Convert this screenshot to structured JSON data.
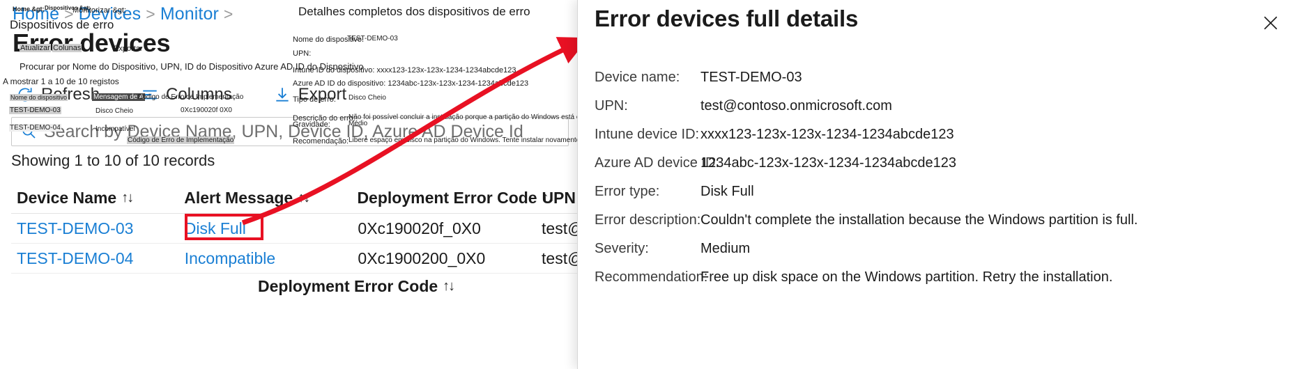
{
  "portal": {
    "breadcrumb": {
      "items": [
        "Home",
        "Devices",
        "Monitor"
      ],
      "separator": ">"
    },
    "page_title": "Error devices",
    "commands": [
      {
        "label": "Refresh",
        "icon": "refresh-icon"
      },
      {
        "label": "Columns",
        "icon": "columns-icon"
      },
      {
        "label": "Export",
        "icon": "export-icon"
      }
    ],
    "search": {
      "placeholder": "Search by Device Name, UPN, Device ID, Azure AD Device Id",
      "value": "",
      "icon": "search-icon"
    },
    "records_status": "Showing 1 to 10 of 10 records",
    "table": {
      "sort_glyph": "↑↓",
      "columns": [
        "Device Name",
        "Alert Message",
        "Deployment Error Code",
        "UPN"
      ],
      "rows": [
        {
          "device_name": "TEST-DEMO-03",
          "alert_message": "Disk Full",
          "error_code": "0Xc190020f_0X0",
          "upn": "test@c"
        },
        {
          "device_name": "TEST-DEMO-04",
          "alert_message": "Incompatible",
          "error_code": "0Xc1900200_0X0",
          "upn": "test@c"
        }
      ],
      "footer_sort_label": "Deployment Error Code"
    },
    "highlight_color": "#e81123",
    "link_color": "#1a7fd4"
  },
  "flyout": {
    "title": "Error devices full details",
    "close_label": "✕",
    "fields": [
      {
        "label": "Device name:",
        "value": "TEST-DEMO-03"
      },
      {
        "label": "UPN:",
        "value": "test@contoso.onmicrosoft.com"
      },
      {
        "label": "Intune device ID:",
        "value": "xxxx123-123x-123x-1234-1234abcde123"
      },
      {
        "label": "Azure AD device ID:",
        "value": "1234abc-123x-123x-1234-1234abcde123"
      },
      {
        "label": "Error type:",
        "value": "Disk Full"
      },
      {
        "label": "Error description:",
        "value": "Couldn't complete the installation because the Windows partition is full."
      },
      {
        "label": "Severity:",
        "value": "Medium"
      },
      {
        "label": "Recommendation:",
        "value": "Free up disk space on the Windows partition. Retry the installation."
      }
    ]
  },
  "translation_overlay": {
    "breadcrumb_1": "Home &gt;",
    "breadcrumb_2": "Dispositivos &gt;",
    "breadcrumb_3": "Monitorizar &gt;",
    "breadcrumb_4": "Dispositivos de erro",
    "cmd_refresh": "Atualizar",
    "cmd_columns": "Colunas",
    "cmd_export": "Exportar",
    "search_placeholder": "Procurar por Nome do Dispositivo, UPN, ID do Dispositivo Azure AD ID do Dispositivo",
    "records_status": "A mostrar 1 a 10 de 10 registos",
    "col_device_name": "Nome do dispositivo",
    "col_alert_message": "Mensagem de A",
    "col_error_code": "Código de Erro de Implementação",
    "row1_device": "TEST-DEMO-03",
    "row1_alert": "Disco Cheio",
    "row1_code": "0Xc190020f 0X0",
    "row2_device": "TEST-DEMO-04",
    "row2_alert": "Incompatível",
    "footer_sort": "Código de Erro de Implementação",
    "panel_title": "Detalhes completos dos dispositivos de erro",
    "lbl_device_name": "Nome do dispositivo:",
    "val_device_name": "TEST-DEMO-03",
    "lbl_upn": "UPN:",
    "lbl_intune_id": "Intune ID do dispositivo: xxxx123-123x-123x-1234-1234abcde123",
    "lbl_aad_id": "Azure AD ID do dispositivo: 1234abc-123x-123x-1234-1234abcde123",
    "lbl_error_type": "Tipo de erro:",
    "val_error_type": "Disco Cheio",
    "lbl_error_desc": "Descrição do erro:",
    "val_error_desc": "Não foi possível concluir a instalação porque a partição do Windows está cheia.",
    "lbl_severity": "Gravidade:",
    "val_severity": "Médio",
    "lbl_recommendation": "Recomendação:",
    "val_recommendation": "Libere espaço em disco na partição do Windows. Tente instalar novamente."
  },
  "annotation": {
    "arrow_color": "#e81123",
    "arrow_description": "curved-red-arrow"
  }
}
